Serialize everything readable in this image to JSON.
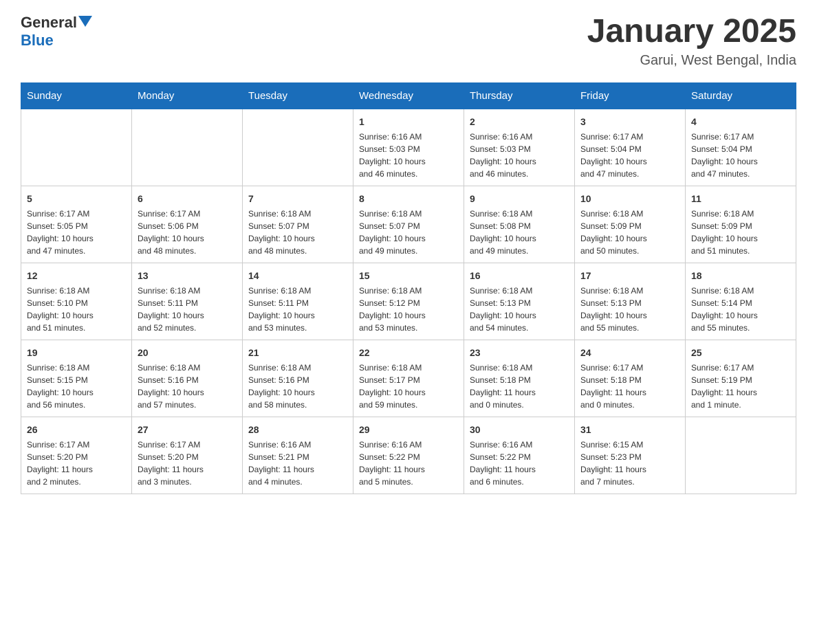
{
  "header": {
    "logo_general": "General",
    "logo_blue": "Blue",
    "title": "January 2025",
    "subtitle": "Garui, West Bengal, India"
  },
  "calendar": {
    "days_of_week": [
      "Sunday",
      "Monday",
      "Tuesday",
      "Wednesday",
      "Thursday",
      "Friday",
      "Saturday"
    ],
    "weeks": [
      [
        {
          "day": "",
          "info": ""
        },
        {
          "day": "",
          "info": ""
        },
        {
          "day": "",
          "info": ""
        },
        {
          "day": "1",
          "info": "Sunrise: 6:16 AM\nSunset: 5:03 PM\nDaylight: 10 hours\nand 46 minutes."
        },
        {
          "day": "2",
          "info": "Sunrise: 6:16 AM\nSunset: 5:03 PM\nDaylight: 10 hours\nand 46 minutes."
        },
        {
          "day": "3",
          "info": "Sunrise: 6:17 AM\nSunset: 5:04 PM\nDaylight: 10 hours\nand 47 minutes."
        },
        {
          "day": "4",
          "info": "Sunrise: 6:17 AM\nSunset: 5:04 PM\nDaylight: 10 hours\nand 47 minutes."
        }
      ],
      [
        {
          "day": "5",
          "info": "Sunrise: 6:17 AM\nSunset: 5:05 PM\nDaylight: 10 hours\nand 47 minutes."
        },
        {
          "day": "6",
          "info": "Sunrise: 6:17 AM\nSunset: 5:06 PM\nDaylight: 10 hours\nand 48 minutes."
        },
        {
          "day": "7",
          "info": "Sunrise: 6:18 AM\nSunset: 5:07 PM\nDaylight: 10 hours\nand 48 minutes."
        },
        {
          "day": "8",
          "info": "Sunrise: 6:18 AM\nSunset: 5:07 PM\nDaylight: 10 hours\nand 49 minutes."
        },
        {
          "day": "9",
          "info": "Sunrise: 6:18 AM\nSunset: 5:08 PM\nDaylight: 10 hours\nand 49 minutes."
        },
        {
          "day": "10",
          "info": "Sunrise: 6:18 AM\nSunset: 5:09 PM\nDaylight: 10 hours\nand 50 minutes."
        },
        {
          "day": "11",
          "info": "Sunrise: 6:18 AM\nSunset: 5:09 PM\nDaylight: 10 hours\nand 51 minutes."
        }
      ],
      [
        {
          "day": "12",
          "info": "Sunrise: 6:18 AM\nSunset: 5:10 PM\nDaylight: 10 hours\nand 51 minutes."
        },
        {
          "day": "13",
          "info": "Sunrise: 6:18 AM\nSunset: 5:11 PM\nDaylight: 10 hours\nand 52 minutes."
        },
        {
          "day": "14",
          "info": "Sunrise: 6:18 AM\nSunset: 5:11 PM\nDaylight: 10 hours\nand 53 minutes."
        },
        {
          "day": "15",
          "info": "Sunrise: 6:18 AM\nSunset: 5:12 PM\nDaylight: 10 hours\nand 53 minutes."
        },
        {
          "day": "16",
          "info": "Sunrise: 6:18 AM\nSunset: 5:13 PM\nDaylight: 10 hours\nand 54 minutes."
        },
        {
          "day": "17",
          "info": "Sunrise: 6:18 AM\nSunset: 5:13 PM\nDaylight: 10 hours\nand 55 minutes."
        },
        {
          "day": "18",
          "info": "Sunrise: 6:18 AM\nSunset: 5:14 PM\nDaylight: 10 hours\nand 55 minutes."
        }
      ],
      [
        {
          "day": "19",
          "info": "Sunrise: 6:18 AM\nSunset: 5:15 PM\nDaylight: 10 hours\nand 56 minutes."
        },
        {
          "day": "20",
          "info": "Sunrise: 6:18 AM\nSunset: 5:16 PM\nDaylight: 10 hours\nand 57 minutes."
        },
        {
          "day": "21",
          "info": "Sunrise: 6:18 AM\nSunset: 5:16 PM\nDaylight: 10 hours\nand 58 minutes."
        },
        {
          "day": "22",
          "info": "Sunrise: 6:18 AM\nSunset: 5:17 PM\nDaylight: 10 hours\nand 59 minutes."
        },
        {
          "day": "23",
          "info": "Sunrise: 6:18 AM\nSunset: 5:18 PM\nDaylight: 11 hours\nand 0 minutes."
        },
        {
          "day": "24",
          "info": "Sunrise: 6:17 AM\nSunset: 5:18 PM\nDaylight: 11 hours\nand 0 minutes."
        },
        {
          "day": "25",
          "info": "Sunrise: 6:17 AM\nSunset: 5:19 PM\nDaylight: 11 hours\nand 1 minute."
        }
      ],
      [
        {
          "day": "26",
          "info": "Sunrise: 6:17 AM\nSunset: 5:20 PM\nDaylight: 11 hours\nand 2 minutes."
        },
        {
          "day": "27",
          "info": "Sunrise: 6:17 AM\nSunset: 5:20 PM\nDaylight: 11 hours\nand 3 minutes."
        },
        {
          "day": "28",
          "info": "Sunrise: 6:16 AM\nSunset: 5:21 PM\nDaylight: 11 hours\nand 4 minutes."
        },
        {
          "day": "29",
          "info": "Sunrise: 6:16 AM\nSunset: 5:22 PM\nDaylight: 11 hours\nand 5 minutes."
        },
        {
          "day": "30",
          "info": "Sunrise: 6:16 AM\nSunset: 5:22 PM\nDaylight: 11 hours\nand 6 minutes."
        },
        {
          "day": "31",
          "info": "Sunrise: 6:15 AM\nSunset: 5:23 PM\nDaylight: 11 hours\nand 7 minutes."
        },
        {
          "day": "",
          "info": ""
        }
      ]
    ]
  }
}
